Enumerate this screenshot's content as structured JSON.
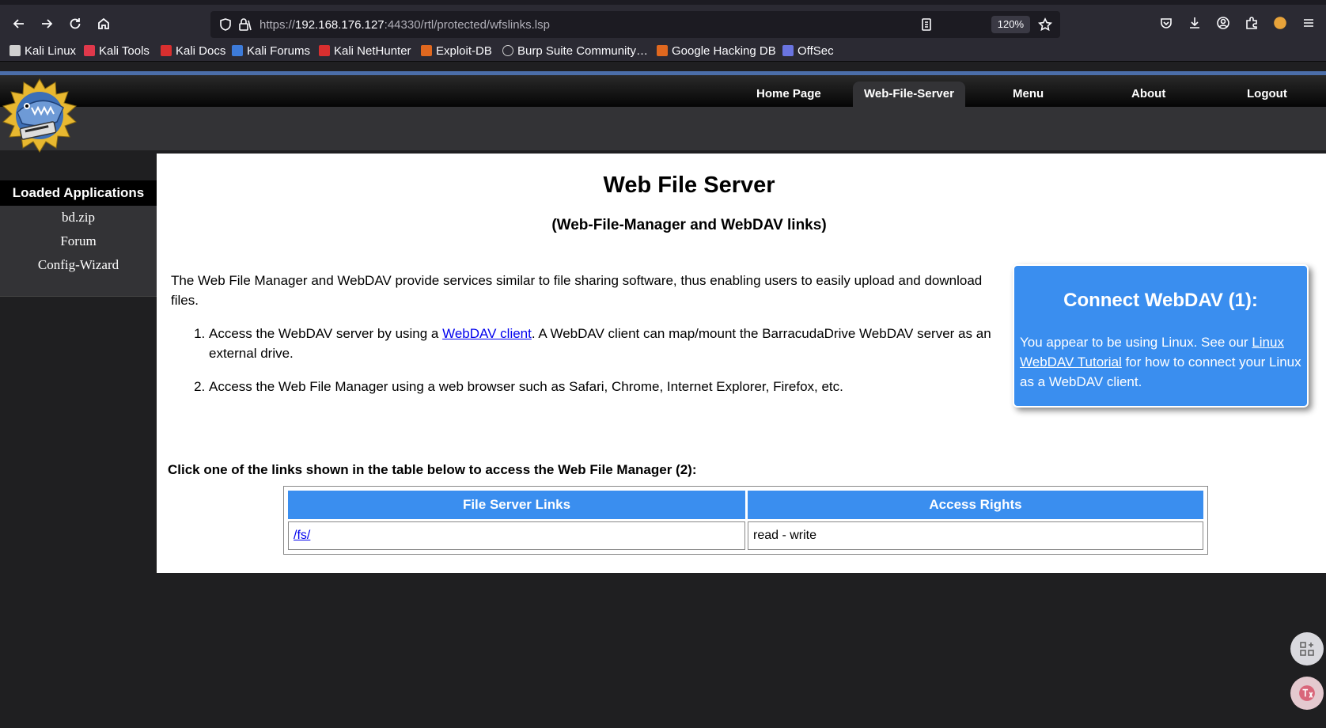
{
  "browser": {
    "url_prefix": "https://",
    "url_host": "192.168.176.127",
    "url_rest": ":44330/rtl/protected/wfslinks.lsp",
    "zoom": "120%",
    "bookmarks": [
      {
        "label": "Kali Linux",
        "color": "#cfcfcf"
      },
      {
        "label": "Kali Tools",
        "color": "#e0384b"
      },
      {
        "label": "Kali Docs",
        "color": "#d92f2f"
      },
      {
        "label": "Kali Forums",
        "color": "#3d7bd9"
      },
      {
        "label": "Kali NetHunter",
        "color": "#d92f2f"
      },
      {
        "label": "Exploit-DB",
        "color": "#e0681f"
      },
      {
        "label": "Burp Suite Community…",
        "color": "#cfcfcf"
      },
      {
        "label": "Google Hacking DB",
        "color": "#e0681f"
      },
      {
        "label": "OffSec",
        "color": "#6a74e0"
      }
    ]
  },
  "nav": {
    "tabs": [
      "Home Page",
      "Web-File-Server",
      "Menu",
      "About",
      "Logout"
    ],
    "active": "Web-File-Server"
  },
  "sidebar": {
    "title": "Loaded Applications",
    "items": [
      "bd.zip",
      "Forum",
      "Config-Wizard"
    ]
  },
  "main": {
    "title": "Web File Server",
    "subtitle": "(Web-File-Manager and WebDAV links)",
    "intro": "The Web File Manager and WebDAV provide services similar to file sharing software, thus enabling users to easily upload and download files.",
    "step1_before": "Access the WebDAV server by using a ",
    "step1_link": "WebDAV client",
    "step1_after": ". A WebDAV client can map/mount the BarracudaDrive WebDAV server as an external drive.",
    "step2": "Access the Web File Manager using a web browser such as Safari, Chrome, Internet Explorer, Firefox, etc.",
    "instruction": "Click one of the links shown in the table below to access the Web File Manager (2):"
  },
  "connect_box": {
    "title": "Connect WebDAV (1):",
    "text_before": "You appear to be using Linux. See our ",
    "link": "Linux WebDAV Tutorial",
    "text_after": " for how to connect your Linux as a WebDAV client."
  },
  "table": {
    "headers": [
      "File Server Links",
      "Access Rights"
    ],
    "rows": [
      {
        "link": "/fs/",
        "rights": "read - write"
      }
    ]
  },
  "colors": {
    "accent": "#3a8eef",
    "header_band": "#4b6ea9"
  }
}
